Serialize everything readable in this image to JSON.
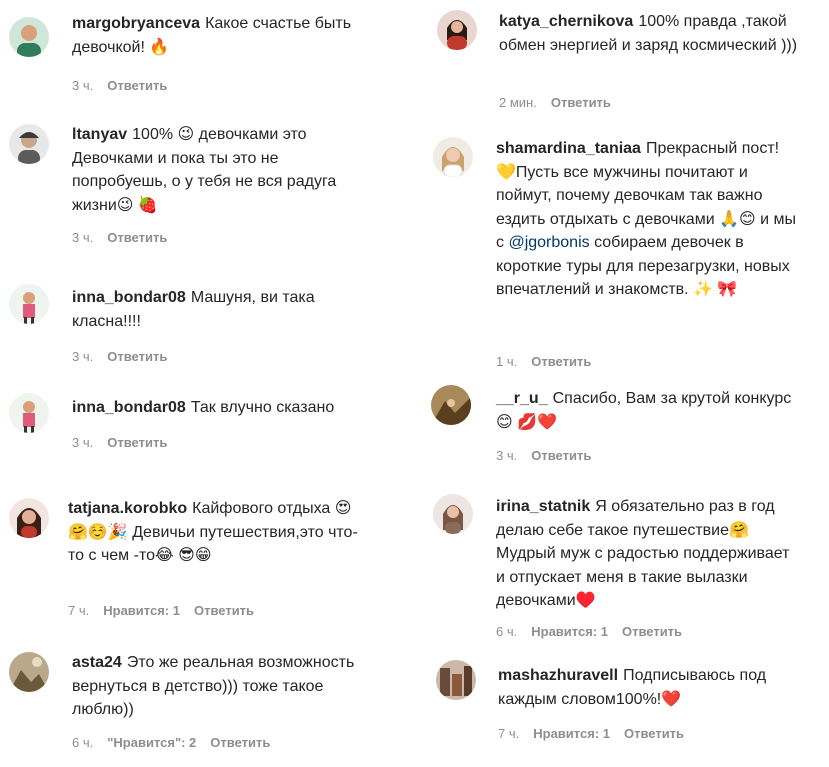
{
  "comments": [
    {
      "user": "margobryanceva",
      "text": "Какое счастье быть девочкой! 🔥",
      "time": "3 ч.",
      "likes": "",
      "reply": "Ответить",
      "avatar_color": "#2e7d5b"
    },
    {
      "user": "ltanyav",
      "text": "100% 😉 девочками это Девочками и пока ты это не попробуешь, о у тебя не вся радуга жизни😉 🍓",
      "time": "3 ч.",
      "likes": "",
      "reply": "Ответить",
      "avatar_color": "#5b5b5b"
    },
    {
      "user": "inna_bondar08",
      "text": "Машуня, ви така класна!!!!",
      "time": "3 ч.",
      "likes": "",
      "reply": "Ответить",
      "avatar_color": "#e05a7a"
    },
    {
      "user": "inna_bondar08",
      "text": "Так влучно сказано",
      "time": "3 ч.",
      "likes": "",
      "reply": "Ответить",
      "avatar_color": "#e05a7a"
    },
    {
      "user": "tatjana.korobko",
      "text": "Кайфового отдыха 😍🤗☺️🎉 Девичьи путешествия,это что-то с чем -то😂 😎😁",
      "time": "7 ч.",
      "likes": "Нравится: 1",
      "reply": "Ответить",
      "avatar_color": "#6b3b2a"
    },
    {
      "user": "asta24",
      "text": "Это же реальная возможность вернуться в детство))) тоже такое люблю))",
      "time": "6 ч.",
      "likes": "\"Нравится\": 2",
      "reply": "Ответить",
      "avatar_color": "#7d6a4a"
    },
    {
      "user": "katya_chernikova",
      "text": "100% правда ,такой обмен энергией и заряд космический )))",
      "time": "2 мин.",
      "likes": "",
      "reply": "Ответить",
      "avatar_color": "#c0392b"
    },
    {
      "user": "shamardina_taniaa",
      "text": "Прекрасный пост! 💛Пусть все мужчины почитают и поймут, почему девочкам так важно ездить отдыхать с девочками 🙏😊 и мы с ",
      "mention": "@jgorbonis",
      "text2": " собираем девочек в короткие туры для перезагрузки, новых впечатлений и знакомств. ✨ 🎀",
      "time": "1 ч.",
      "likes": "",
      "reply": "Ответить",
      "avatar_color": "#c9a36b"
    },
    {
      "user": "__r_u_",
      "text": "Спасибо, Вам за крутой конкурс😊 💋❤️",
      "time": "3 ч.",
      "likes": "",
      "reply": "Ответить",
      "avatar_color": "#7a5a30"
    },
    {
      "user": "irina_statnik",
      "text": "Я обязательно раз в год делаю себе такое путешествие🤗 Мудрый муж с радостью поддерживает и отпускает меня в такие вылазки девочками♥️",
      "time": "6 ч.",
      "likes": "Нравится: 1",
      "reply": "Ответить",
      "avatar_color": "#8a6a5a"
    },
    {
      "user": "mashazhuravell",
      "text": "Подписываюсь под каждым словом100%!❤️",
      "time": "7 ч.",
      "likes": "Нравится: 1",
      "reply": "Ответить",
      "avatar_color": "#6a4a3a"
    }
  ]
}
